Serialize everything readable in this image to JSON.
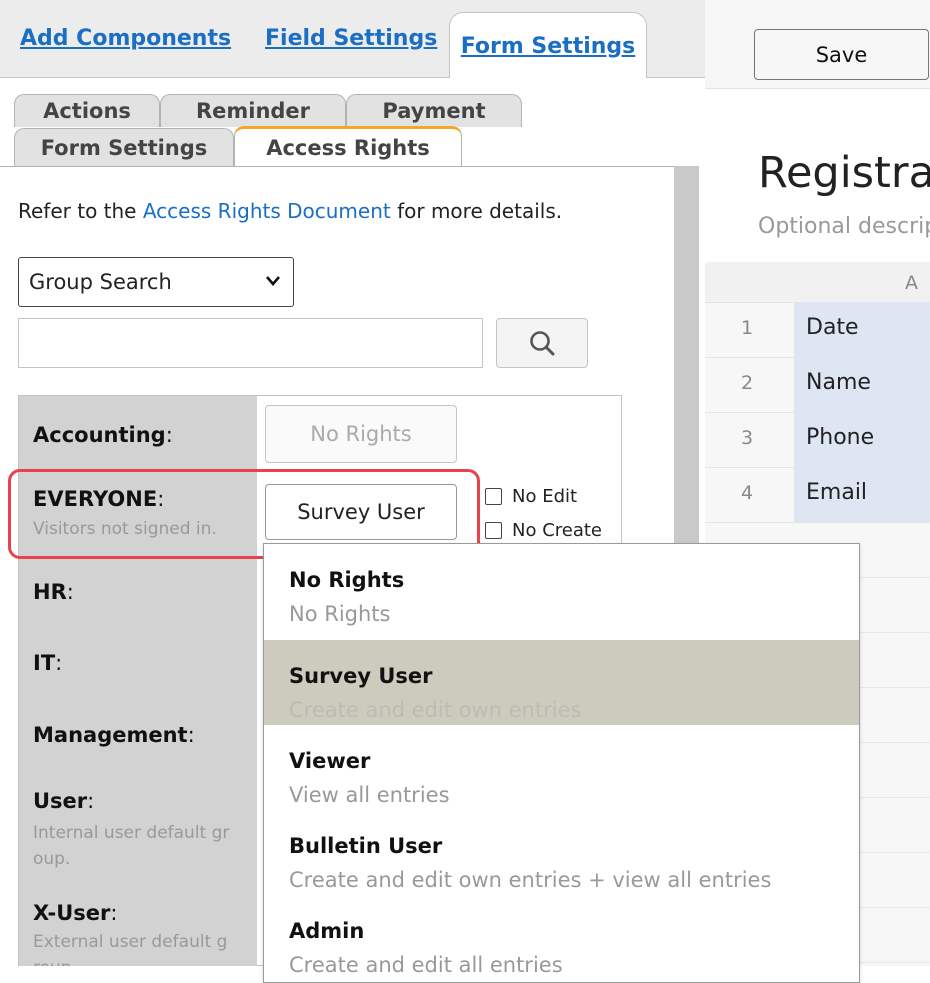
{
  "top_tabs": {
    "add_components": "Add Components",
    "field_settings": "Field Settings",
    "form_settings": "Form Settings"
  },
  "sub_tabs": {
    "actions": "Actions",
    "reminder": "Reminder",
    "payment": "Payment",
    "form_settings": "Form Settings",
    "access_rights": "Access Rights"
  },
  "refer": {
    "prefix": "Refer to the ",
    "link": "Access Rights Document",
    "suffix": " for more details."
  },
  "group_search": {
    "selected": "Group Search",
    "input_value": "",
    "search_icon": "magnifier-icon"
  },
  "groups": [
    {
      "name": "Accounting",
      "desc": "",
      "rights": "No Rights"
    },
    {
      "name": "EVERYONE",
      "desc": "Visitors not signed in.",
      "rights": "Survey User"
    },
    {
      "name": "HR",
      "desc": ""
    },
    {
      "name": "IT",
      "desc": ""
    },
    {
      "name": "Management",
      "desc": ""
    },
    {
      "name": "User",
      "desc": "Internal user default gr oup."
    },
    {
      "name": "X-User",
      "desc": "External user default g roup."
    }
  ],
  "colon": ":",
  "checkboxes": {
    "no_edit": "No Edit",
    "no_create": "No Create"
  },
  "dropdown": {
    "selected_index": 1,
    "options": [
      {
        "title": "No Rights",
        "desc": "No Rights"
      },
      {
        "title": "Survey User",
        "desc": "Create and edit own entries"
      },
      {
        "title": "Viewer",
        "desc": "View all entries"
      },
      {
        "title": "Bulletin User",
        "desc": "Create and edit own entries + view all entries"
      },
      {
        "title": "Admin",
        "desc": "Create and edit all entries"
      }
    ]
  },
  "right": {
    "save_label": "Save",
    "form_title": "Registration",
    "form_desc": "Optional description",
    "column_a": "A",
    "rows": [
      {
        "num": "1",
        "value": "Date"
      },
      {
        "num": "2",
        "value": "Name"
      },
      {
        "num": "3",
        "value": "Phone"
      },
      {
        "num": "4",
        "value": "Email"
      }
    ]
  },
  "colors": {
    "link": "#1a6fc4",
    "highlight": "#e8434d",
    "active_tab_accent": "#f5a623",
    "selected_option": "#cdcbbd"
  }
}
